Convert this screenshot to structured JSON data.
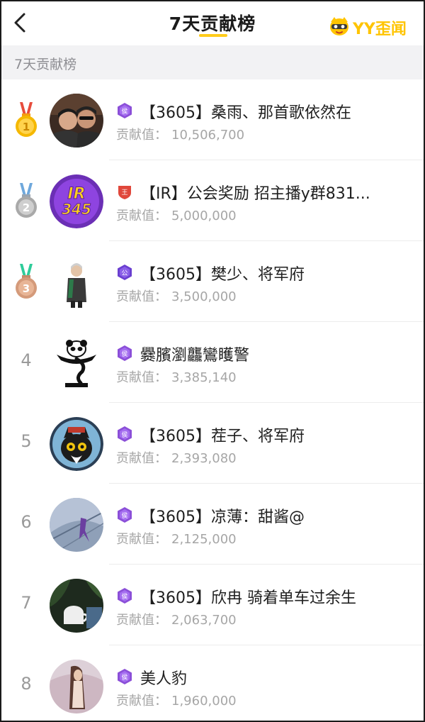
{
  "header": {
    "title": "7天贡献榜",
    "logo_text": "YY歪闻"
  },
  "section": {
    "label": "7天贡献榜"
  },
  "contrib_label": "贡献值：",
  "colors": {
    "accent": "#ffcc1a",
    "gold": "#f5b800",
    "silver": "#b6b6b6",
    "bronze": "#d49a7a",
    "purple_badge": "#8b4fd8",
    "red_badge": "#e0473b"
  },
  "rows": [
    {
      "rank": "1",
      "medal": "gold",
      "badge": "侯",
      "badge_color": "purple",
      "name": "【3605】桑雨、那首歌依然在",
      "value": "10,506,700"
    },
    {
      "rank": "2",
      "medal": "silver",
      "badge": "王",
      "badge_color": "red",
      "name": "【IR】公会奖励 招主播y群831...",
      "value": "5,000,000"
    },
    {
      "rank": "3",
      "medal": "bronze",
      "badge": "公",
      "badge_color": "purple",
      "name": "【3605】樊少、将军府",
      "value": "3,500,000"
    },
    {
      "rank": "4",
      "medal": "",
      "badge": "侯",
      "badge_color": "purple",
      "name": "爨臏瀏龘鸞矆警",
      "value": "3,385,140"
    },
    {
      "rank": "5",
      "medal": "",
      "badge": "侯",
      "badge_color": "purple",
      "name": "【3605】茬子、将军府",
      "value": "2,393,080"
    },
    {
      "rank": "6",
      "medal": "",
      "badge": "侯",
      "badge_color": "purple",
      "name": "【3605】凉薄：甜酱@",
      "value": "2,125,000"
    },
    {
      "rank": "7",
      "medal": "",
      "badge": "侯",
      "badge_color": "purple",
      "name": "【3605】欣冉 骑着单车过余生",
      "value": "2,063,700"
    },
    {
      "rank": "8",
      "medal": "",
      "badge": "侯",
      "badge_color": "purple",
      "name": "美人豹",
      "value": "1,960,000"
    }
  ]
}
